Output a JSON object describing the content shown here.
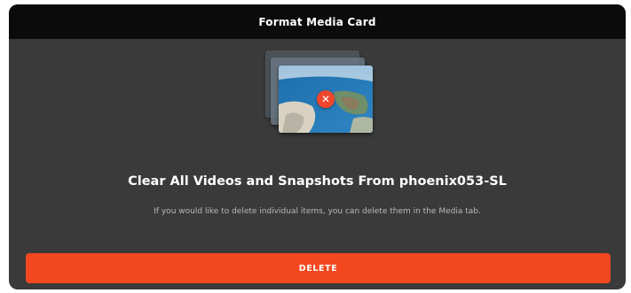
{
  "dialog": {
    "title": "Format Media Card",
    "headline": "Clear All Videos and Snapshots From phoenix053-SL",
    "subtext": "If you would like to delete individual items, you can delete them in the Media tab.",
    "delete_label": "DELETE",
    "media_badge_glyph": "✕"
  },
  "colors": {
    "titlebar_bg": "#0b0b0b",
    "dialog_bg": "#3a3a3a",
    "accent": "#f2471f",
    "badge": "#f0462b"
  },
  "icons": {
    "media_stack": "media-thumbnails-stack-icon",
    "badge": "close-icon"
  }
}
